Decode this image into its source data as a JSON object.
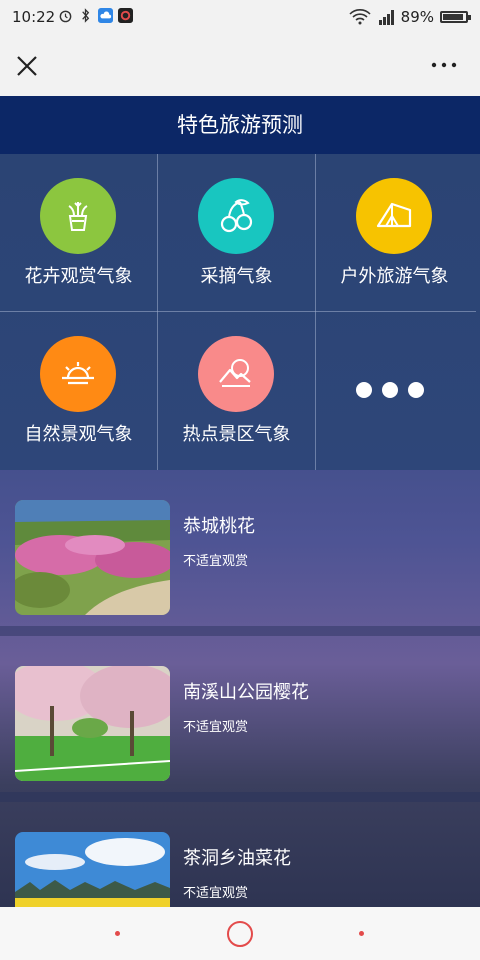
{
  "status_bar": {
    "time": "10:22",
    "battery_text": "89%",
    "battery_level": 0.89,
    "network": "4G",
    "icons": [
      "alarm-icon",
      "bluetooth-icon",
      "cloud-icon",
      "app-icon",
      "wifi-icon",
      "signal-icon",
      "battery-icon"
    ]
  },
  "navbar": {
    "close_icon": "close-icon",
    "more_icon": "more-icon"
  },
  "page": {
    "title": "特色旅游预测"
  },
  "categories": [
    {
      "label": "花卉观赏气象",
      "icon": "flower-pot-icon",
      "color": "#8cc63f"
    },
    {
      "label": "采摘气象",
      "icon": "cherry-icon",
      "color": "#18c6c0"
    },
    {
      "label": "户外旅游气象",
      "icon": "tent-icon",
      "color": "#f7c300"
    },
    {
      "label": "自然景观气象",
      "icon": "sunrise-icon",
      "color": "#ff8a14"
    },
    {
      "label": "热点景区气象",
      "icon": "mountain-icon",
      "color": "#f98a8a"
    },
    {
      "label": "",
      "icon": "more-dots-icon",
      "color": "#ffffff"
    }
  ],
  "spots": [
    {
      "title": "恭城桃花",
      "status": "不适宜观赏"
    },
    {
      "title": "南溪山公园樱花",
      "status": "不适宜观赏"
    },
    {
      "title": "茶洞乡油菜花",
      "status": "不适宜观赏"
    }
  ],
  "colors": {
    "header_bg": "#0c2766",
    "accent_red": "#e34b4b"
  }
}
